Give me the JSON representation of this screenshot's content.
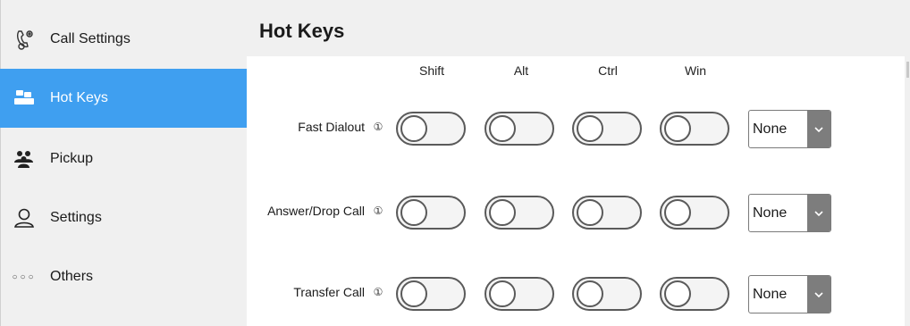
{
  "sidebar": {
    "items": [
      {
        "label": "Call Settings",
        "icon": "call-settings-icon",
        "active": false
      },
      {
        "label": "Hot Keys",
        "icon": "hot-keys-icon",
        "active": true
      },
      {
        "label": "Pickup",
        "icon": "pickup-group-icon",
        "active": false
      },
      {
        "label": "Settings",
        "icon": "user-settings-icon",
        "active": false
      },
      {
        "label": "Others",
        "icon": "more-dots-icon",
        "dots": "○○○",
        "active": false
      }
    ]
  },
  "main": {
    "title": "Hot Keys",
    "columns": [
      "Shift",
      "Alt",
      "Ctrl",
      "Win"
    ],
    "info_glyph": "①",
    "rows": [
      {
        "label": "Fast Dialout",
        "shift": false,
        "alt": false,
        "ctrl": false,
        "win": false,
        "key": "None"
      },
      {
        "label": "Answer/Drop Call",
        "shift": false,
        "alt": false,
        "ctrl": false,
        "win": false,
        "key": "None"
      },
      {
        "label": "Transfer Call",
        "shift": false,
        "alt": false,
        "ctrl": false,
        "win": false,
        "key": "None"
      }
    ]
  },
  "colors": {
    "active_nav": "#3f9ff0",
    "panel": "#ffffff",
    "background": "#f0f0f0",
    "dropdown_arrow_bg": "#7d7d7d"
  }
}
